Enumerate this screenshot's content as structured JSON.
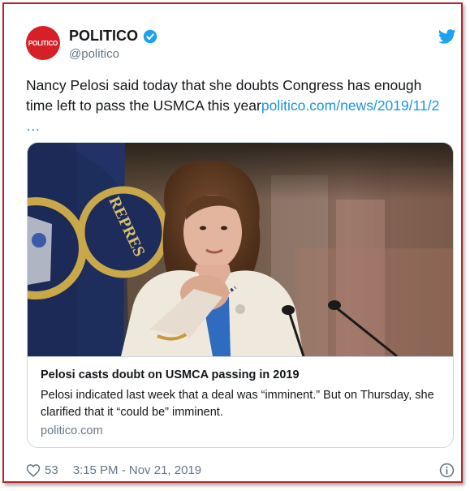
{
  "account": {
    "avatar_text": "POLITICO",
    "name": "POLITICO",
    "handle": "@politico",
    "verified": true
  },
  "tweet": {
    "text": "Nancy Pelosi said today that she doubts Congress has enough time left to pass the USMCA this year",
    "link": "politico.com/news/2019/11/2",
    "ellipsis": "…"
  },
  "card": {
    "title": "Pelosi casts doubt on USMCA passing in 2019",
    "description": "Pelosi indicated last week that a deal was “imminent.” But on Thursday, she clarified that it “could be” imminent.",
    "domain": "politico.com"
  },
  "footer": {
    "likes": "53",
    "timestamp": "3:15 PM - Nov 21, 2019"
  },
  "icons": {
    "brand": "twitter-bird-icon",
    "like": "heart-icon",
    "info": "info-icon",
    "verified": "verified-badge-icon"
  },
  "colors": {
    "frame": "#b3262a",
    "avatar": "#d71f28",
    "link": "#1b95e0",
    "verified": "#1da1f2",
    "muted": "#657786"
  }
}
